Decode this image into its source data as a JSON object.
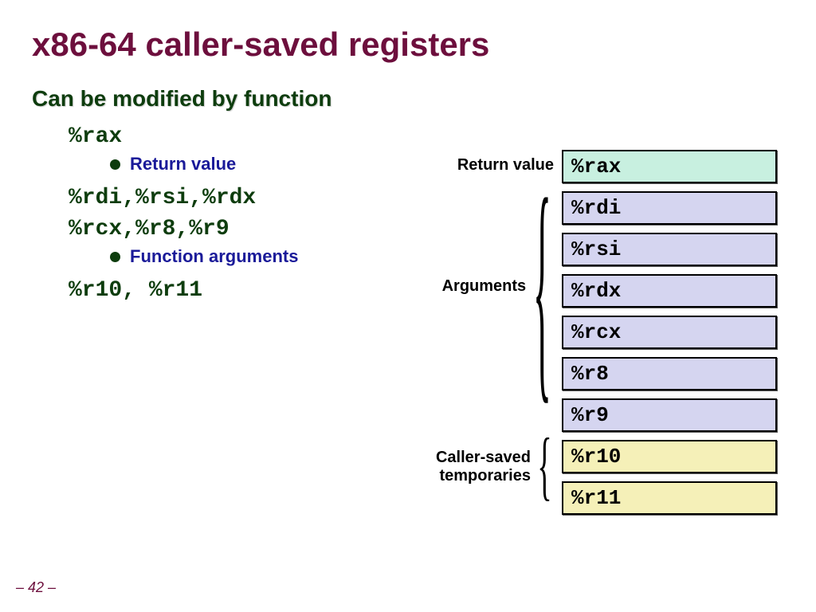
{
  "title": "x86-64 caller-saved registers",
  "subtitle": "Can be modified by function",
  "left": {
    "reg1": "%rax",
    "bullet1": "Return value",
    "reg2a": "%rdi,%rsi,%rdx",
    "reg2b": "%rcx,%r8,%r9",
    "bullet2": "Function arguments",
    "reg3": "%r10, %r11"
  },
  "labels": {
    "return": "Return value",
    "args": "Arguments",
    "temps_line1": "Caller-saved",
    "temps_line2": "temporaries"
  },
  "registers": {
    "rax": "%rax",
    "rdi": "%rdi",
    "rsi": "%rsi",
    "rdx": "%rdx",
    "rcx": "%rcx",
    "r8": "%r8",
    "r9": "%r9",
    "r10": "%r10",
    "r11": "%r11"
  },
  "page": "– 42 –"
}
